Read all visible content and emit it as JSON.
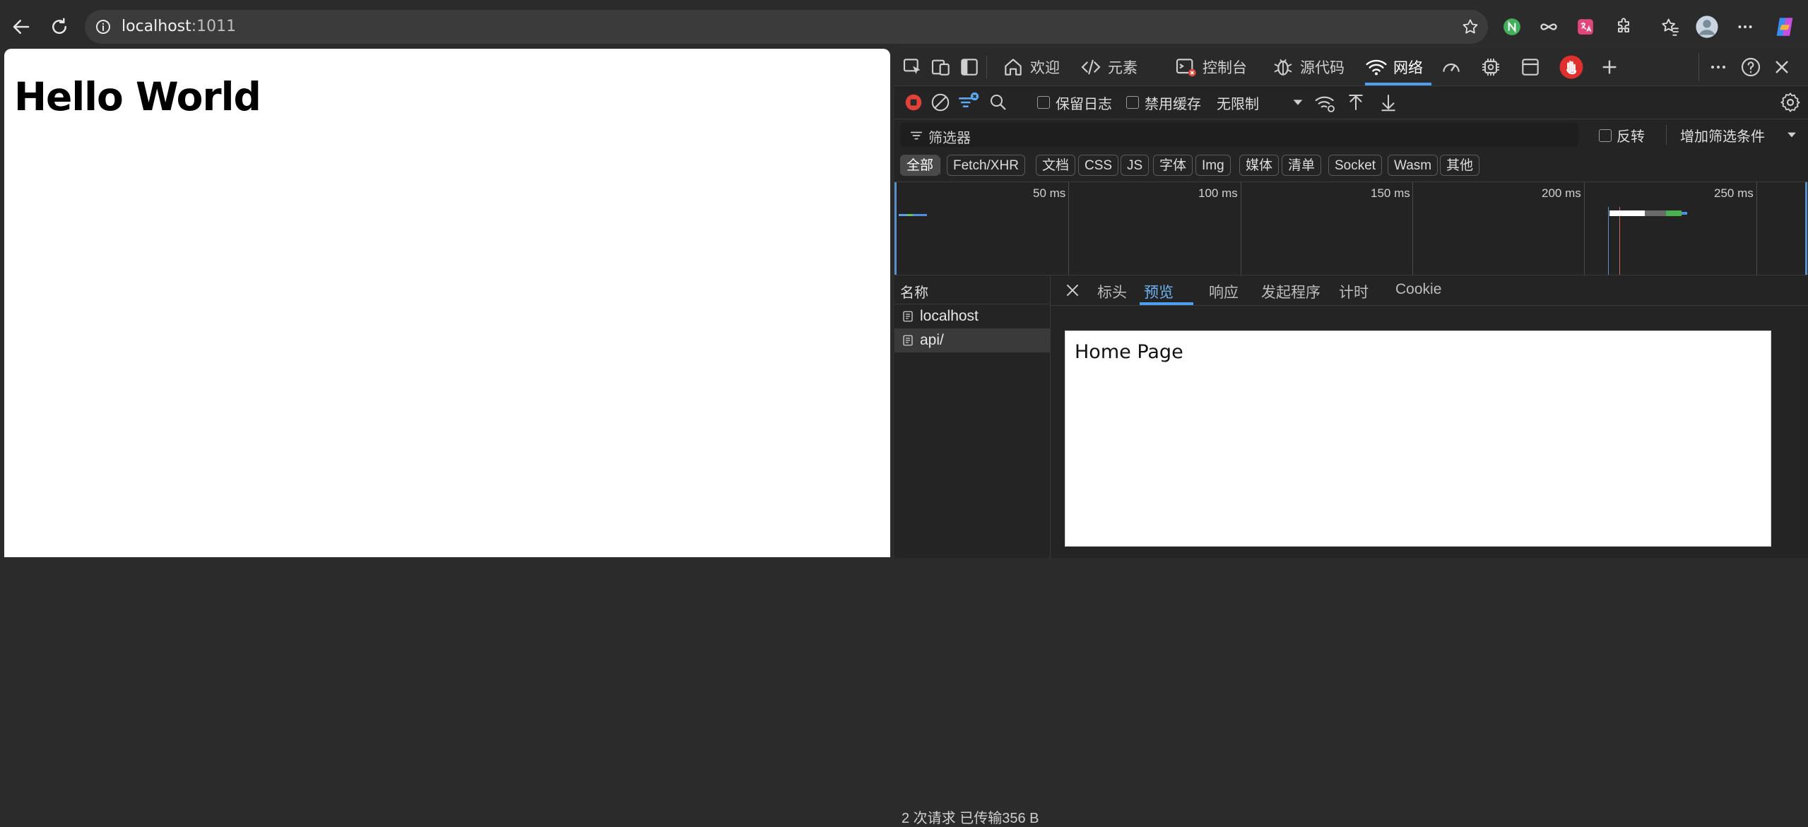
{
  "browser": {
    "address_host": "localhost",
    "address_port": ":1011"
  },
  "page": {
    "heading": "Hello World"
  },
  "devtools": {
    "tabs": [
      {
        "label": "欢迎"
      },
      {
        "label": "元素"
      },
      {
        "label": "控制台"
      },
      {
        "label": "源代码"
      },
      {
        "label": "网络"
      }
    ],
    "network_toolbar": {
      "preserve_log": "保留日志",
      "disable_cache": "禁用缓存",
      "throttling": "无限制"
    },
    "filter": {
      "placeholder": "筛选器",
      "invert": "反转",
      "more_filters": "增加筛选条件"
    },
    "type_filters": [
      "全部",
      "Fetch/XHR",
      "文档",
      "CSS",
      "JS",
      "字体",
      "Img",
      "媒体",
      "清单",
      "Socket",
      "Wasm",
      "其他"
    ],
    "overview_ticks": [
      "50 ms",
      "100 ms",
      "150 ms",
      "200 ms",
      "250 ms"
    ],
    "requests": {
      "header": "名称",
      "items": [
        {
          "name": "localhost"
        },
        {
          "name": "api/"
        }
      ]
    },
    "detail_tabs": [
      "标头",
      "预览",
      "响应",
      "发起程序",
      "计时",
      "Cookie"
    ],
    "preview_text": "Home Page",
    "status": "2 次请求  已传输356 B"
  }
}
